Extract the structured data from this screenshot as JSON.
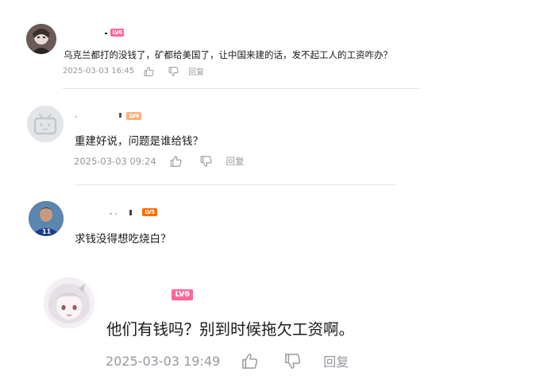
{
  "comments": [
    {
      "username": "",
      "level": "LV6",
      "level_color": "#ff6699",
      "text": "乌克兰都打的没钱了，矿都给美国了，让中国来建的话，发不起工人的工资咋办？",
      "time": "2025-03-03 16:45",
      "reply_label": "回复",
      "avatar_icon": "anime-avatar"
    },
    {
      "username": "",
      "level": "LV4",
      "level_color": "#ffb37c",
      "text": "重建好说，问题是谁给钱？",
      "time": "2025-03-03 09:24",
      "reply_label": "回复",
      "avatar_icon": "default-tv-avatar"
    },
    {
      "username": "",
      "level": "LV5",
      "level_color": "#ff6c00",
      "text": "求钱没得想吃烧白？",
      "time": "",
      "reply_label": "",
      "avatar_icon": "football-player-avatar"
    },
    {
      "username": "",
      "level": "LV6",
      "level_color": "#ff6699",
      "text": "他们有钱吗？别到时候拖欠工资啊。",
      "time": "2025-03-03 19:49",
      "reply_label": "回复",
      "avatar_icon": "anime-girl-avatar"
    }
  ],
  "colors": {
    "text": "#18191c",
    "meta": "#9499a0",
    "divider": "#e3e5e7"
  }
}
